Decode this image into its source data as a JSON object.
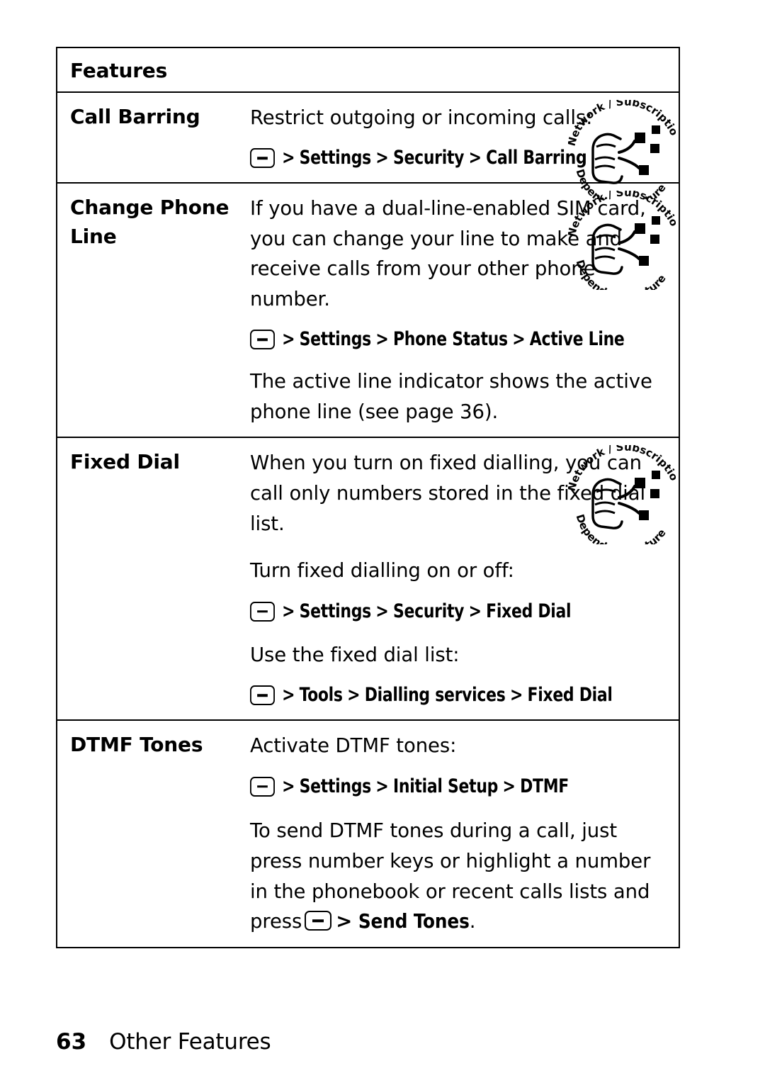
{
  "table": {
    "header": "Features",
    "rows": [
      {
        "name": "Call Barring",
        "blocks": [
          {
            "type": "text",
            "text": "Restrict outgoing or incoming calls:"
          },
          {
            "type": "path",
            "items": [
              "Settings",
              "Security",
              "Call Barring"
            ]
          }
        ],
        "badge": true
      },
      {
        "name": "Change Phone Line",
        "blocks": [
          {
            "type": "text",
            "text": "If you have a dual-line-enabled SIM card, you can change your line to make and receive calls from your other phone number."
          },
          {
            "type": "path",
            "items": [
              "Settings",
              "Phone Status",
              "Active Line"
            ]
          },
          {
            "type": "text",
            "text": "The active line indicator shows the active phone line (see page 36)."
          }
        ],
        "badge": true
      },
      {
        "name": "Fixed Dial",
        "blocks": [
          {
            "type": "text",
            "text": "When you turn on fixed dialling, you can call only numbers stored in the fixed dial list."
          },
          {
            "type": "text",
            "text": "Turn fixed dialling on or off:"
          },
          {
            "type": "path",
            "items": [
              "Settings",
              "Security",
              "Fixed Dial"
            ]
          },
          {
            "type": "text",
            "text": "Use the fixed dial list:"
          },
          {
            "type": "path",
            "items": [
              "Tools",
              "Dialling services",
              "Fixed Dial"
            ]
          }
        ],
        "badge": true
      },
      {
        "name": "DTMF Tones",
        "blocks": [
          {
            "type": "text",
            "text": "Activate DTMF tones:"
          },
          {
            "type": "path",
            "items": [
              "Settings",
              "Initial Setup",
              "DTMF"
            ]
          },
          {
            "type": "text-inline-key",
            "before": "To send DTMF tones during a call, just press number keys or highlight a number in the phonebook or recent calls lists and press",
            "after": "Send Tones",
            "sep": ">",
            "end": "."
          }
        ],
        "badge": false
      }
    ]
  },
  "badge": {
    "line1": "Network / Subscription",
    "line2": "Dependent Feature"
  },
  "footer": {
    "page": "63",
    "title": "Other Features"
  },
  "colors": {
    "ink": "#000000",
    "paper": "#ffffff"
  }
}
